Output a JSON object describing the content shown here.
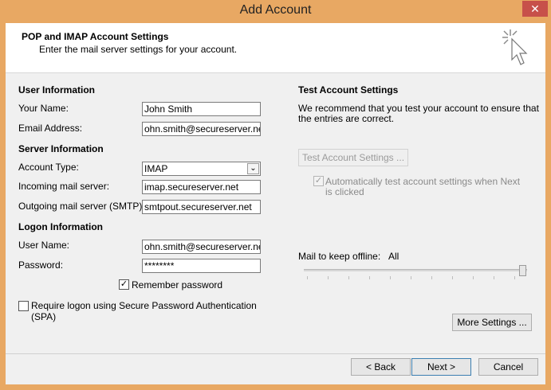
{
  "window": {
    "title": "Add Account",
    "close_glyph": "✕"
  },
  "header": {
    "title": "POP and IMAP Account Settings",
    "subtitle": "Enter the mail server settings for your account.",
    "icon": "wizard-cursor-icon"
  },
  "user_info": {
    "section": "User Information",
    "name_label": "Your Name:",
    "name_value": "John Smith",
    "email_label": "Email Address:",
    "email_value": "ohn.smith@secureserver.net"
  },
  "server_info": {
    "section": "Server Information",
    "account_type_label": "Account Type:",
    "account_type_value": "IMAP",
    "incoming_label": "Incoming mail server:",
    "incoming_value": "imap.secureserver.net",
    "outgoing_label": "Outgoing mail server (SMTP):",
    "outgoing_value": "smtpout.secureserver.net"
  },
  "logon_info": {
    "section": "Logon Information",
    "username_label": "User Name:",
    "username_value": "ohn.smith@secureserver.net",
    "password_label": "Password:",
    "password_value": "********",
    "remember_label": "Remember password",
    "remember_checked": true,
    "spa_label_line1": "Require logon using Secure Password Authentication",
    "spa_label_line2": "(SPA)",
    "spa_checked": false
  },
  "test_settings": {
    "section": "Test Account Settings",
    "desc_line1": "We recommend that you test your account to ensure that",
    "desc_line2": "the entries are correct.",
    "test_button": "Test Account Settings ...",
    "auto_test_line1": "Automatically test account settings when Next",
    "auto_test_line2": "is clicked",
    "auto_test_checked": true
  },
  "offline": {
    "label": "Mail to keep offline:",
    "value": "All",
    "level": 1.0
  },
  "buttons": {
    "more_settings": "More Settings ...",
    "back": "< Back",
    "next": "Next >",
    "cancel": "Cancel"
  }
}
